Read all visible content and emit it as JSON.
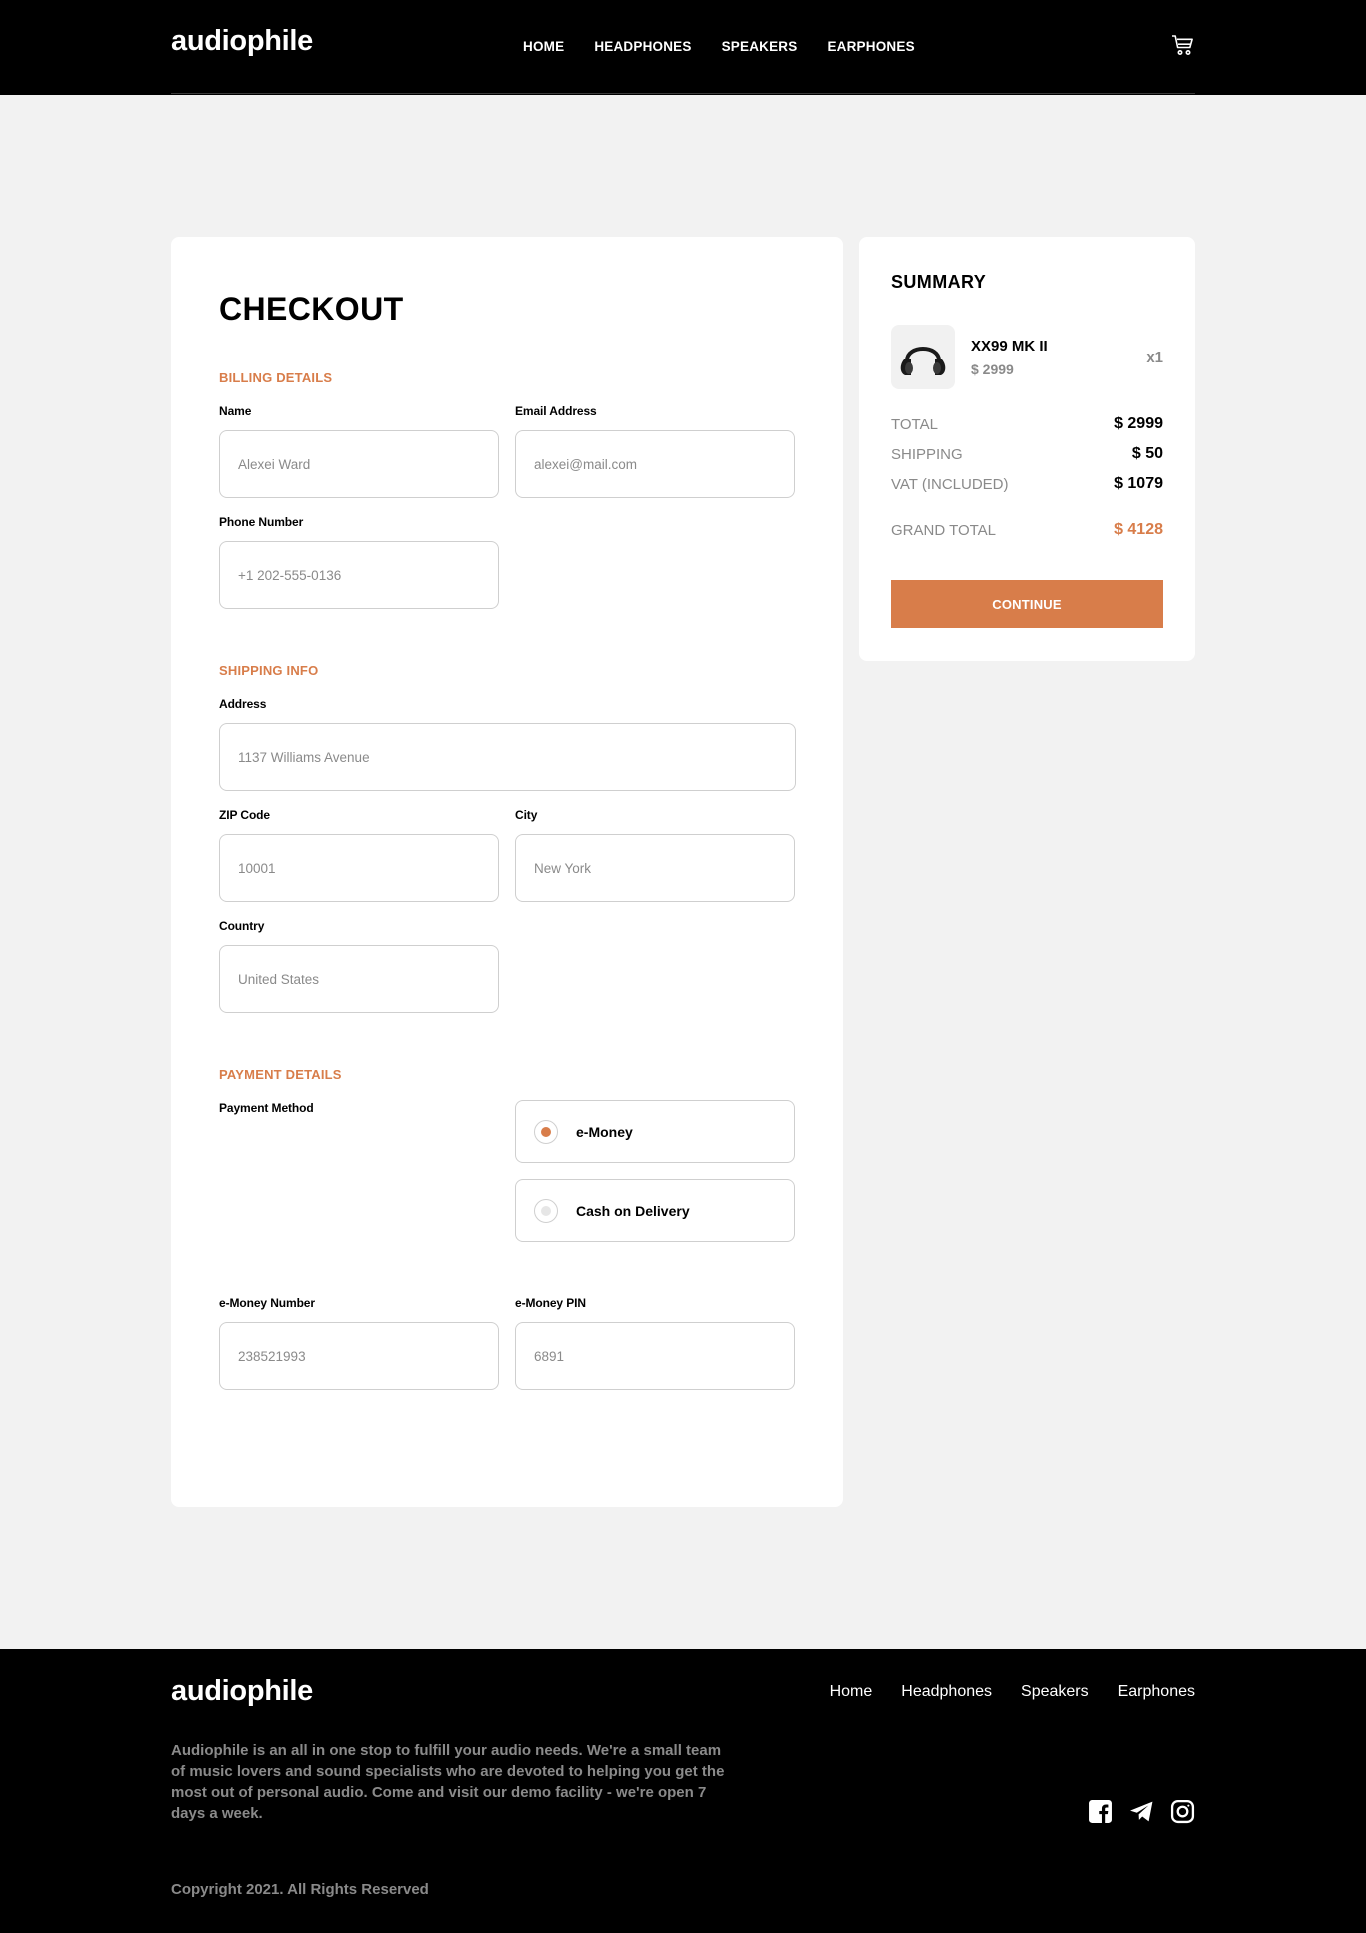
{
  "header": {
    "logo": "audiophile",
    "nav": [
      "HOME",
      "HEADPHONES",
      "SPEAKERS",
      "EARPHONES"
    ],
    "cart_icon": "cart-icon"
  },
  "checkout": {
    "title": "CHECKOUT",
    "billing": {
      "title": "BILLING DETAILS",
      "name_label": "Name",
      "name_placeholder": "Alexei Ward",
      "email_label": "Email Address",
      "email_placeholder": "alexei@mail.com",
      "phone_label": "Phone Number",
      "phone_placeholder": "+1 202-555-0136"
    },
    "shipping": {
      "title": "SHIPPING INFO",
      "address_label": "Address",
      "address_placeholder": "1137 Williams Avenue",
      "zip_label": "ZIP Code",
      "zip_placeholder": "10001",
      "city_label": "City",
      "city_placeholder": "New York",
      "country_label": "Country",
      "country_placeholder": "United States"
    },
    "payment": {
      "title": "PAYMENT DETAILS",
      "method_label": "Payment Method",
      "options": [
        "e-Money",
        "Cash on Delivery"
      ],
      "selected": "e-Money",
      "emoney_number_label": "e-Money Number",
      "emoney_number_placeholder": "238521993",
      "emoney_pin_label": "e-Money PIN",
      "emoney_pin_placeholder": "6891"
    }
  },
  "summary": {
    "title": "SUMMARY",
    "item": {
      "name": "XX99 MK II",
      "price": "$ 2999",
      "qty": "x1",
      "icon": "headphones-icon"
    },
    "total_label": "TOTAL",
    "total_value": "$ 2999",
    "shipping_label": "SHIPPING",
    "shipping_value": "$ 50",
    "vat_label": "VAT (INCLUDED)",
    "vat_value": "$ 1079",
    "grand_total_label": "GRAND TOTAL",
    "grand_total_value": "$ 4128",
    "continue_label": "CONTINUE"
  },
  "footer": {
    "logo": "audiophile",
    "nav": [
      "Home",
      "Headphones",
      "Speakers",
      "Earphones"
    ],
    "description": "Audiophile is an all in one stop to fulfill your audio needs. We're a small team of music lovers and sound specialists who are devoted to helping you get the most out of personal audio. Come and visit our demo facility - we're open 7 days a week.",
    "social_icons": [
      "facebook-icon",
      "telegram-icon",
      "instagram-icon"
    ],
    "copyright": "Copyright 2021. All Rights Reserved"
  },
  "colors": {
    "accent": "#d87d4a",
    "dark": "#000000",
    "page_bg": "#f2f2f2"
  }
}
